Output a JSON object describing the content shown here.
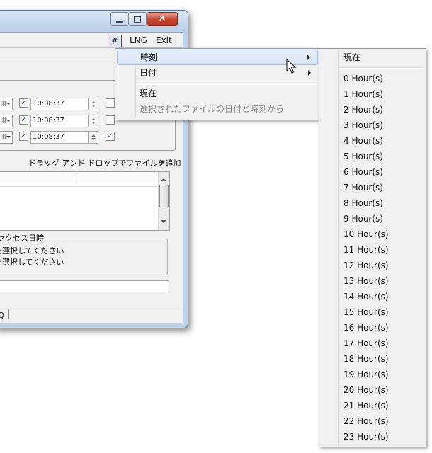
{
  "menubar": {
    "hash": "#",
    "lng": "LNG",
    "exit": "Exit"
  },
  "rows": [
    {
      "checked": true,
      "time": "10:08:37",
      "extra_checkbox": false
    },
    {
      "checked": true,
      "time": "10:08:37",
      "extra_checkbox": false
    },
    {
      "checked": true,
      "time": "10:08:37",
      "extra_checkbox": true
    }
  ],
  "check_mark": "✓",
  "dnd_label": "ドラッグ アンド ドロップでファイルを追加",
  "group": {
    "title": "ァクセス日時",
    "lines": [
      "を選択してください",
      "を選択してください"
    ]
  },
  "status": {
    "text": "AQ"
  },
  "popup_menu": {
    "items": [
      {
        "label": "時刻",
        "submenu": true,
        "highlighted": true
      },
      {
        "label": "日付",
        "submenu": true,
        "highlighted": false
      },
      {
        "label": "現在",
        "submenu": false,
        "highlighted": false
      },
      {
        "label": "選択されたファイルの日付と時刻から",
        "submenu": false,
        "disabled": true
      }
    ]
  },
  "submenu": {
    "now_label": "現在",
    "hours": [
      "0 Hour(s)",
      "1 Hour(s)",
      "2 Hour(s)",
      "3 Hour(s)",
      "4 Hour(s)",
      "5 Hour(s)",
      "6 Hour(s)",
      "7 Hour(s)",
      "8 Hour(s)",
      "9 Hour(s)",
      "10 Hour(s)",
      "11 Hour(s)",
      "12 Hour(s)",
      "13 Hour(s)",
      "14 Hour(s)",
      "15 Hour(s)",
      "16 Hour(s)",
      "17 Hour(s)",
      "18 Hour(s)",
      "19 Hour(s)",
      "20 Hour(s)",
      "21 Hour(s)",
      "22 Hour(s)",
      "23 Hour(s)"
    ]
  },
  "colors": {
    "accent": "#d7e4f6",
    "title_bar": "#bcd3ea",
    "close_button": "#c6432e"
  },
  "icons": {
    "close": "close-icon",
    "minimize": "minimize-icon",
    "maximize": "maximize-icon",
    "cursor": "mouse-pointer-icon"
  }
}
